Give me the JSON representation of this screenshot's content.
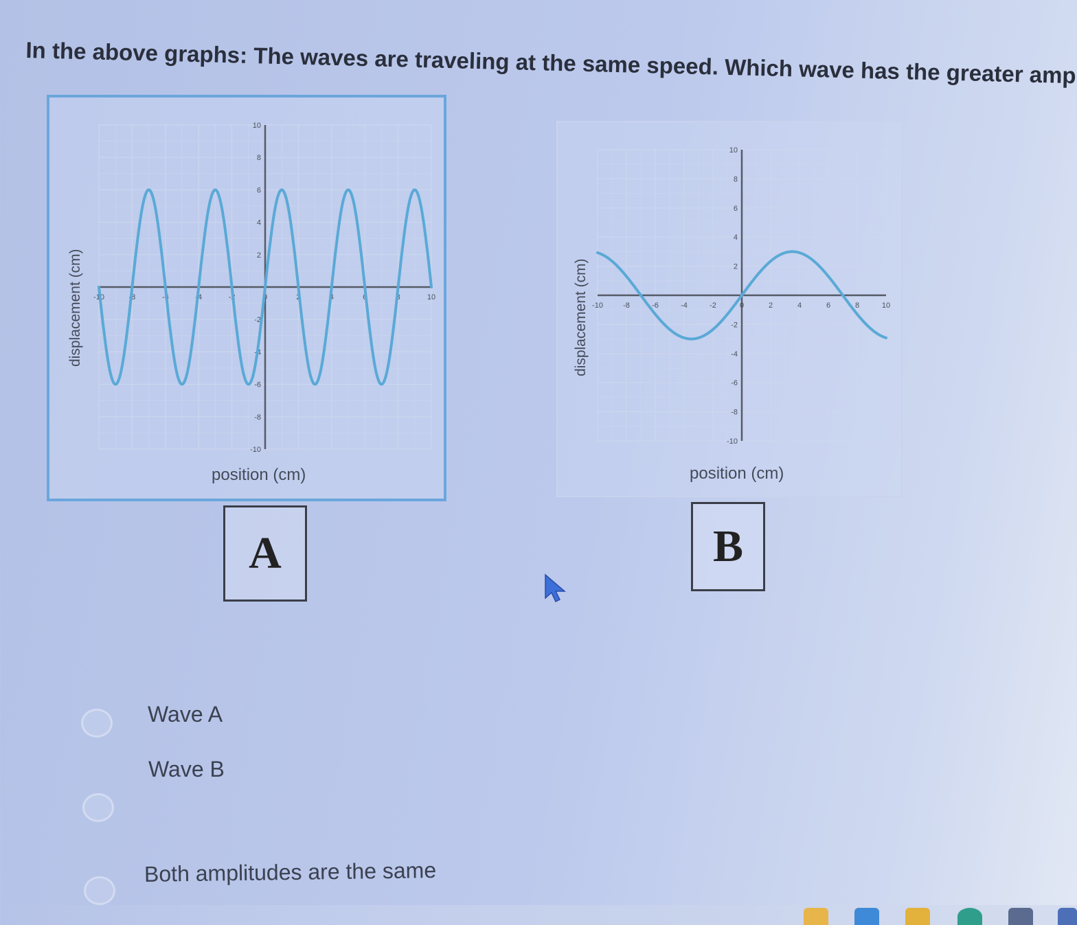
{
  "question": {
    "text": "In the above graphs: The waves are traveling at the same speed. Which wave has the greater amplitude?"
  },
  "graphs": [
    {
      "id": "A",
      "ylabel": "displacement (cm)",
      "xlabel": "position (cm)",
      "box_label": "A",
      "chart_data": {
        "type": "line",
        "xlim": [
          -10,
          10
        ],
        "ylim": [
          -10,
          10
        ],
        "x_ticks": [
          -10,
          -8,
          -6,
          -4,
          -2,
          0,
          2,
          4,
          6,
          8,
          10
        ],
        "y_ticks": [
          10,
          8,
          6,
          4,
          2,
          -2,
          -4,
          -6,
          -8,
          -10
        ],
        "series": [
          {
            "amplitude": 6,
            "wavelength": 4,
            "color": "#5aa9d6"
          }
        ],
        "grid": true
      }
    },
    {
      "id": "B",
      "ylabel": "displacement (cm)",
      "xlabel": "position (cm)",
      "box_label": "B",
      "chart_data": {
        "type": "line",
        "xlim": [
          -10,
          10
        ],
        "ylim": [
          -10,
          10
        ],
        "x_ticks": [
          -10,
          -8,
          -6,
          -4,
          -2,
          0,
          2,
          4,
          6,
          8,
          10
        ],
        "y_ticks": [
          10,
          8,
          6,
          4,
          2,
          -2,
          -4,
          -6,
          -8,
          -10
        ],
        "series": [
          {
            "amplitude": 3,
            "wavelength": 14,
            "color": "#5aa9d6"
          }
        ],
        "grid": true
      }
    }
  ],
  "options": [
    {
      "label": "Wave A"
    },
    {
      "label": "Wave B"
    },
    {
      "label": "Both amplitudes are the same"
    }
  ],
  "colors": {
    "wave": "#5aa9d6",
    "panel_a_border": "#6aa6dc",
    "background": "#b8c6ea"
  }
}
